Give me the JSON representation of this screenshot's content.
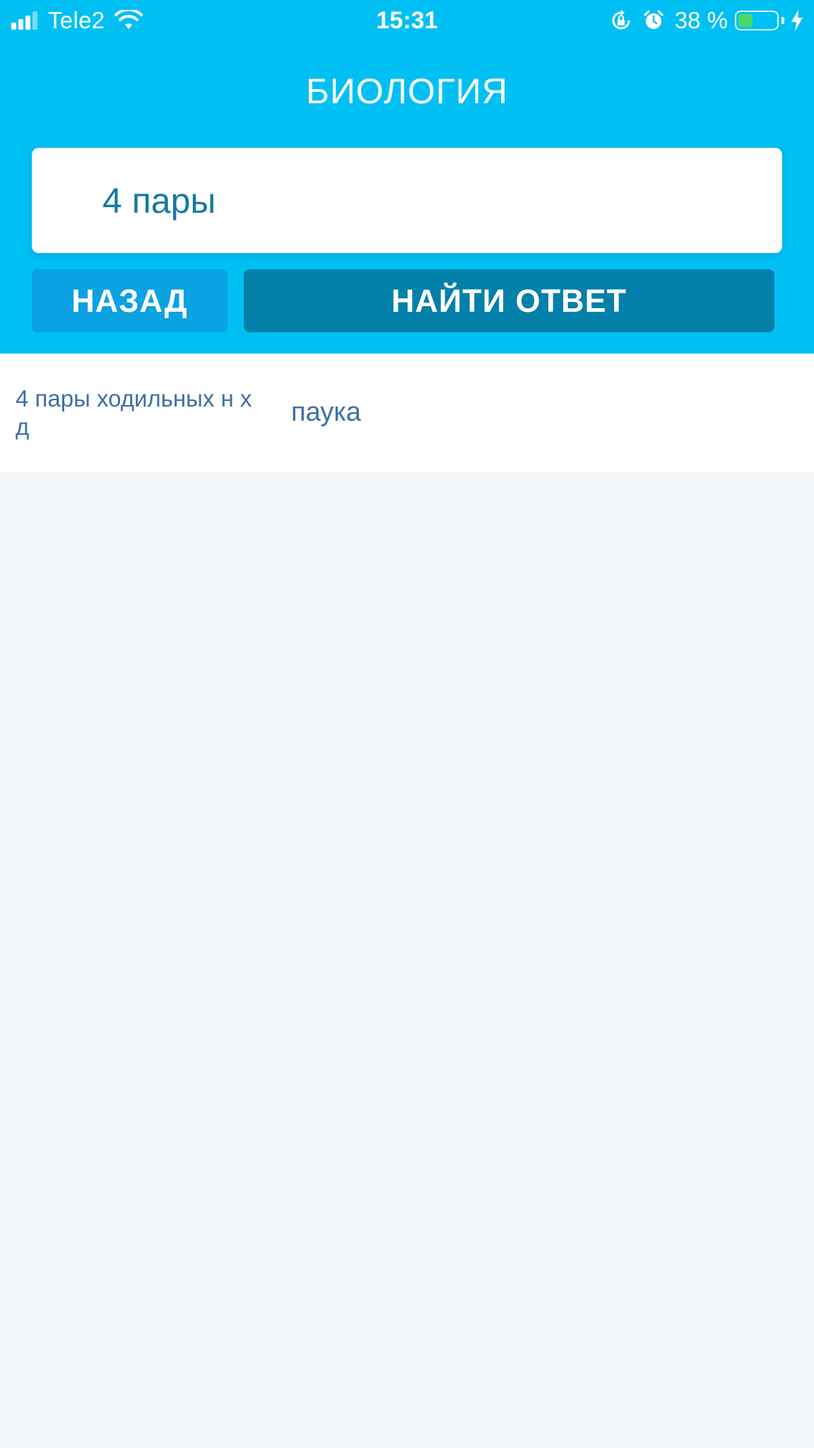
{
  "status_bar": {
    "carrier": "Tele2",
    "time": "15:31",
    "battery_percent": "38 %",
    "battery_level": 0.38,
    "icons": [
      "signal-icon",
      "wifi-icon",
      "rotation-lock-icon",
      "alarm-icon",
      "battery-icon",
      "charging-bolt-icon"
    ]
  },
  "header": {
    "title": "БИОЛОГИЯ"
  },
  "search": {
    "value": "4 пары"
  },
  "buttons": {
    "back_label": "НАЗАД",
    "find_label": "НАЙТИ ОТВЕТ"
  },
  "results": [
    {
      "question": "4 пары ходильных н х д",
      "answer": "паука"
    }
  ],
  "colors": {
    "header_bg": "#00c0f3",
    "back_button": "#0aa2e0",
    "find_button": "#0280a9",
    "search_text": "#137aa3",
    "result_text": "#3f6ea8",
    "battery_fill": "#4cd964"
  }
}
